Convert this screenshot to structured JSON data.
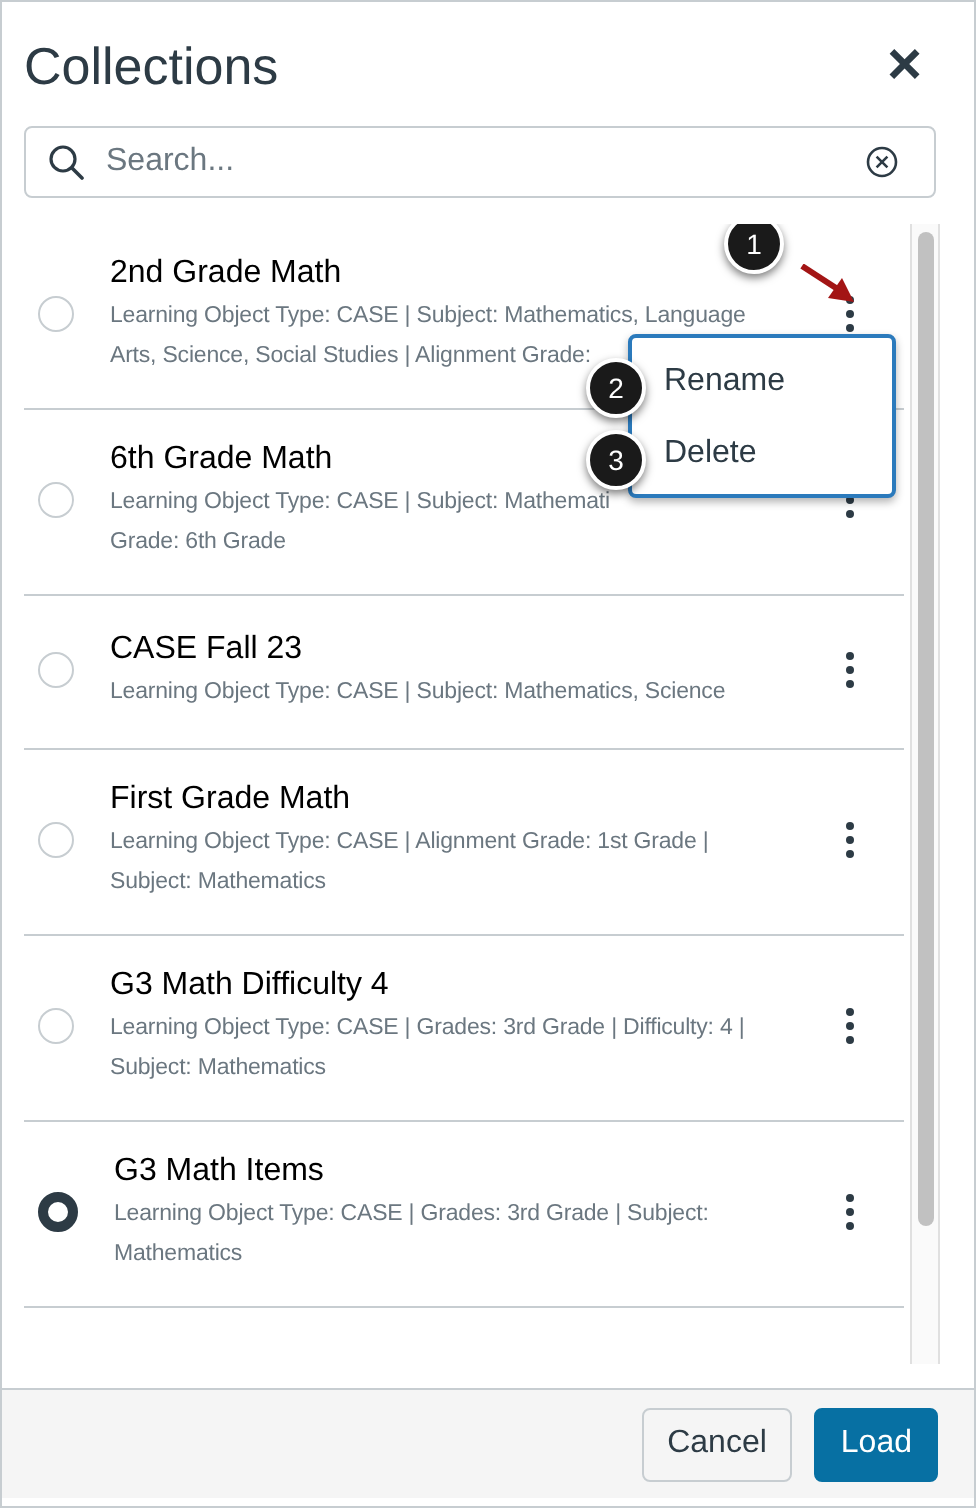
{
  "dialog": {
    "title": "Collections",
    "close": "×"
  },
  "search": {
    "placeholder": "Search..."
  },
  "collections": [
    {
      "title": "2nd Grade Math",
      "meta": [
        "Learning Object Type: CASE | Subject: Mathematics, Language",
        "Arts, Science, Social Studies | Alignment Grade:"
      ],
      "selected": false,
      "menu_open": true
    },
    {
      "title": "6th Grade Math",
      "meta": [
        "Learning Object Type: CASE | Subject: Mathemati",
        "Grade: 6th Grade"
      ],
      "selected": false,
      "menu_open": false
    },
    {
      "title": "CASE Fall 23",
      "meta": [
        "Learning Object Type: CASE | Subject: Mathematics, Science"
      ],
      "selected": false,
      "menu_open": false
    },
    {
      "title": "First Grade Math",
      "meta": [
        "Learning Object Type: CASE | Alignment Grade: 1st Grade |",
        "Subject: Mathematics"
      ],
      "selected": false,
      "menu_open": false
    },
    {
      "title": "G3 Math Difficulty 4",
      "meta": [
        "Learning Object Type: CASE | Grades: 3rd Grade | Difficulty: 4 |",
        "Subject: Mathematics"
      ],
      "selected": false,
      "menu_open": false
    },
    {
      "title": "G3 Math Items",
      "meta": [
        "Learning Object Type: CASE | Grades: 3rd Grade | Subject:",
        "Mathematics"
      ],
      "selected": true,
      "menu_open": false
    }
  ],
  "menu": {
    "items": [
      {
        "label": "Rename",
        "callout": "2"
      },
      {
        "label": "Delete",
        "callout": "3"
      }
    ]
  },
  "callout": "1",
  "buttons": [
    {
      "label": "Cancel",
      "kind": "secondary"
    },
    {
      "label": "Load",
      "kind": "primary"
    }
  ]
}
